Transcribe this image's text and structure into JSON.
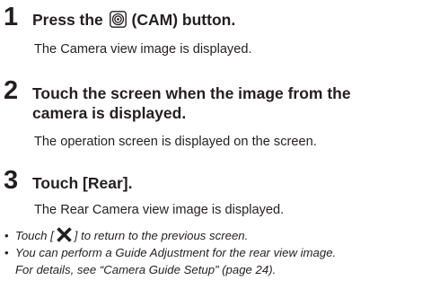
{
  "steps": [
    {
      "number": "1",
      "title_before": "Press the",
      "title_after": "(CAM) button.",
      "description": "The Camera view image is displayed."
    },
    {
      "number": "2",
      "title_line1": "Touch the screen when the image from the",
      "title_line2": "camera is displayed.",
      "description": "The operation screen is displayed on the screen."
    },
    {
      "number": "3",
      "title": "Touch [Rear].",
      "description": "The Rear Camera view image is displayed."
    }
  ],
  "notes": {
    "bullet": "•",
    "note1_before": "Touch [",
    "note1_after": "] to return to the previous screen.",
    "note2_line1": "You can perform a Guide Adjustment for the rear view image.",
    "note2_line2": "For details, see “Camera Guide Setup” (page 24)."
  },
  "icons": {
    "cam_button": "camera-button-icon",
    "close": "close-x-icon"
  }
}
